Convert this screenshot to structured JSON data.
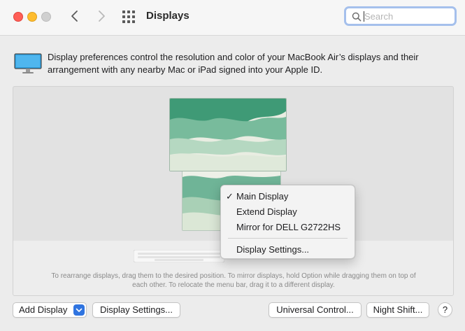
{
  "window": {
    "title": "Displays",
    "search": {
      "placeholder": "Search",
      "value": ""
    }
  },
  "description": "Display preferences control the resolution and color of your MacBook Air’s displays and their arrangement with any nearby Mac or iPad signed into your Apple ID.",
  "arrangement": {
    "hint": "To rearrange displays, drag them to the desired position. To mirror displays, hold Option while dragging them on top of each other. To relocate the menu bar, drag it to a different display."
  },
  "context_menu": {
    "items": [
      {
        "label": "Main Display",
        "checked": true,
        "check": "✓"
      },
      {
        "label": "Extend Display",
        "checked": false
      },
      {
        "label": "Mirror for DELL G2722HS",
        "checked": false
      },
      {
        "label": "Display Settings...",
        "checked": false
      }
    ]
  },
  "buttons": {
    "add_display": "Add Display",
    "display_settings": "Display Settings...",
    "universal_control": "Universal Control...",
    "night_shift": "Night Shift...",
    "help": "?"
  },
  "colors": {
    "accent": "#2f74e0",
    "close": "#ff5f57",
    "minimize": "#febc2e",
    "search_focus_ring": "#a5c0ec"
  }
}
